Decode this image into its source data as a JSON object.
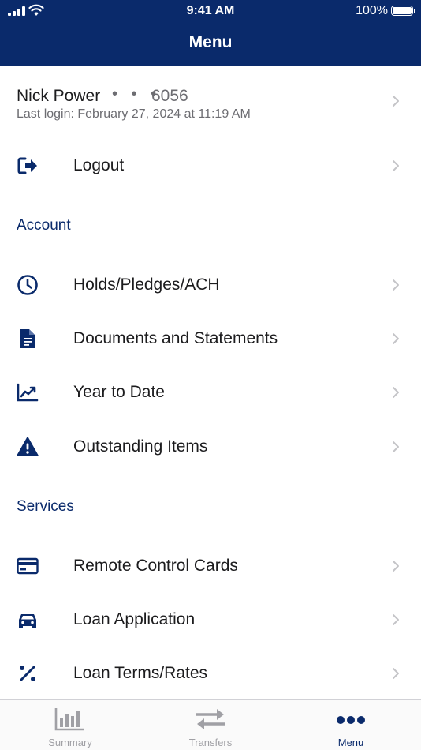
{
  "status_bar": {
    "time": "9:41 AM",
    "battery": "100%",
    "battery_level": 1.0
  },
  "header": {
    "title": "Menu"
  },
  "user": {
    "name": "Nick Power",
    "masked": "• • •",
    "account": "6056",
    "last_login": "Last login: February 27, 2024 at 11:19 AM"
  },
  "logout": {
    "label": "Logout",
    "icon": "logout-icon"
  },
  "account_section": {
    "title": "Account",
    "items": [
      {
        "label": "Holds/Pledges/ACH",
        "icon": "clock-icon"
      },
      {
        "label": "Documents and Statements",
        "icon": "document-icon"
      },
      {
        "label": "Year to Date",
        "icon": "chart-line-icon"
      },
      {
        "label": "Outstanding Items",
        "icon": "warning-icon"
      }
    ]
  },
  "services_section": {
    "title": "Services",
    "items": [
      {
        "label": "Remote Control Cards",
        "icon": "credit-card-icon"
      },
      {
        "label": "Loan Application",
        "icon": "car-icon"
      },
      {
        "label": "Loan Terms/Rates",
        "icon": "percent-icon"
      }
    ]
  },
  "tabs": [
    {
      "label": "Summary",
      "icon": "bar-chart-icon",
      "active": false
    },
    {
      "label": "Transfers",
      "icon": "transfer-arrows-icon",
      "active": false
    },
    {
      "label": "Menu",
      "icon": "more-dots-icon",
      "active": true
    }
  ],
  "colors": {
    "brand": "#0a2a6b",
    "inactive": "#a0a0a5",
    "chevron": "#c4c4c7"
  }
}
